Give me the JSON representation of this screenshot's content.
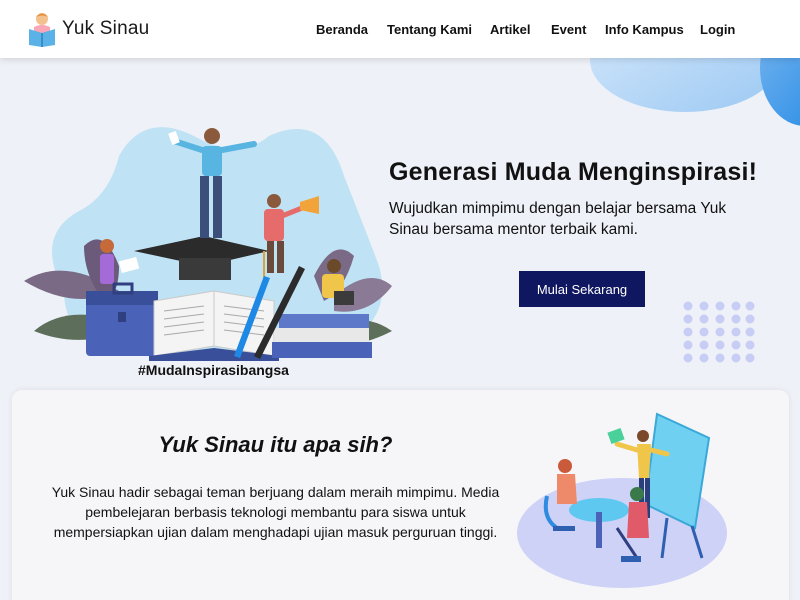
{
  "brand": {
    "name": "Yuk Sinau",
    "logo_icon": "reading-person-logo-icon"
  },
  "nav": {
    "items": [
      {
        "label": "Beranda"
      },
      {
        "label": "Tentang Kami"
      },
      {
        "label": "Artikel"
      },
      {
        "label": "Event"
      },
      {
        "label": "Info Kampus"
      },
      {
        "label": "Login"
      }
    ]
  },
  "hero": {
    "title": "Generasi Muda Menginspirasi!",
    "subtitle": "Wujudkan mimpimu dengan belajar bersama Yuk Sinau bersama mentor terbaik kami.",
    "cta_label": "Mulai Sekarang",
    "hashtag": "#MudaInspirasibangsa"
  },
  "about": {
    "title": "Yuk Sinau itu apa sih?",
    "text": "Yuk Sinau hadir sebagai teman berjuang dalam meraih mimpimu. Media pembelejaran berbasis teknologi membantu para siswa untuk mempersiapkan ujian dalam menghadapi ujian masuk perguruan tinggi."
  },
  "colors": {
    "cta_bg": "#0f1760",
    "accent_blue": "#1e88e5",
    "hero_bg": "#eef1f7"
  }
}
